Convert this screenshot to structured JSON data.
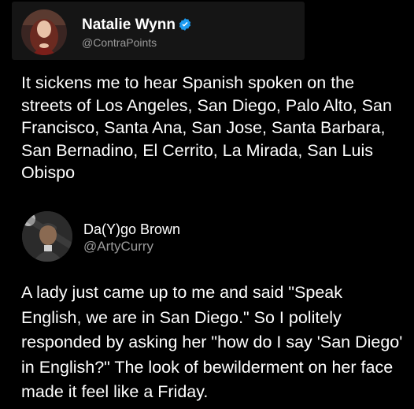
{
  "tweet": {
    "author_name": "Natalie Wynn",
    "author_handle": "@ContraPoints",
    "verified": true,
    "text": "It sickens me to hear Spanish spoken on the streets of Los Angeles, San Diego, Palo Alto, San Francisco, Santa Ana, San Jose, Santa Barbara, San Bernadino, El Cerrito, La Mirada, San Luis Obispo",
    "avatar_icon": "profile-photo",
    "verified_icon": "verified-badge-icon"
  },
  "reply": {
    "author_name": "Da(Y)go Brown",
    "author_handle": "@ArtyCurry",
    "text": "A lady just came up to me and said \"Speak English, we are in San Diego.\" So I politely responded by asking her \"how do I say 'San Diego' in English?\" The look of bewilderment on her face made it feel like a Friday.",
    "avatar_icon": "profile-photo"
  },
  "colors": {
    "background": "#000000",
    "card": "#151515",
    "text": "#ffffff",
    "muted": "#9a9a9a",
    "verified": "#1d9bf0"
  }
}
